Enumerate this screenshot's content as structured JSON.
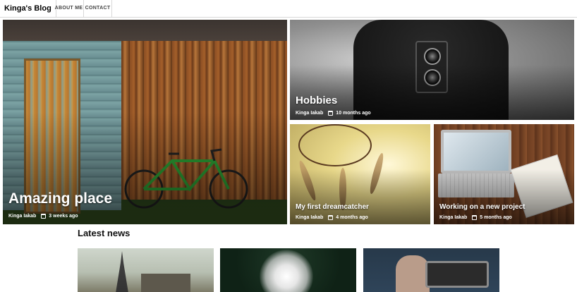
{
  "brand": "Kinga's Blog",
  "nav": {
    "about": "ABOUT ME",
    "contact": "CONTACT"
  },
  "featured": [
    {
      "title": "Amazing place",
      "author": "Kinga Iakab",
      "time": "3 weeks ago"
    },
    {
      "title": "Hobbies",
      "author": "Kinga Iakab",
      "time": "10 months ago"
    },
    {
      "title": "My first dreamcatcher",
      "author": "Kinga Iakab",
      "time": "4 months ago"
    },
    {
      "title": "Working on a new project",
      "author": "Kinga Iakab",
      "time": "5 months ago"
    }
  ],
  "latest_news_title": "Latest news",
  "icons": {
    "date": "calendar-icon"
  }
}
